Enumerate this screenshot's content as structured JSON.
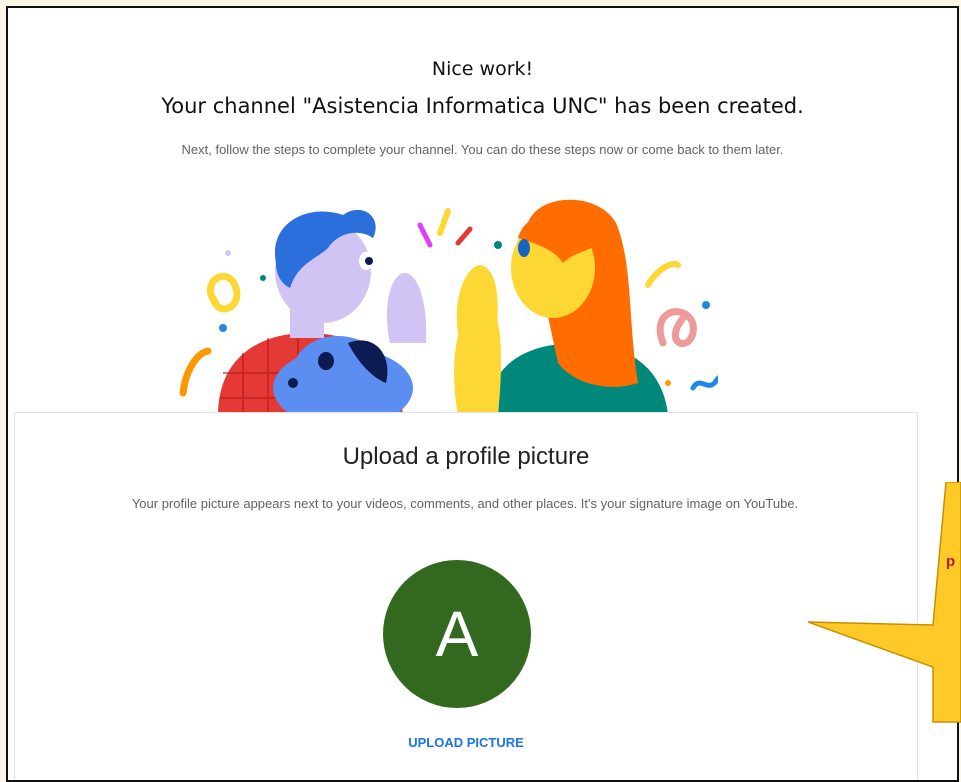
{
  "header": {
    "title_line1": "Nice work!",
    "title_line2": "Your channel \"Asistencia Informatica UNC\" has been created.",
    "subtitle": "Next, follow the steps to complete your channel. You can do these steps now or come back to them later."
  },
  "card": {
    "title": "Upload a profile picture",
    "description": "Your profile picture appears next to your videos, comments, and other places. It's your signature image on YouTube.",
    "avatar_letter": "A",
    "upload_label": "UPLOAD PICTURE"
  },
  "callout": {
    "text": "p"
  },
  "colors": {
    "avatar_bg": "#33691e",
    "link": "#1a73e8",
    "callout": "#ffca28"
  }
}
